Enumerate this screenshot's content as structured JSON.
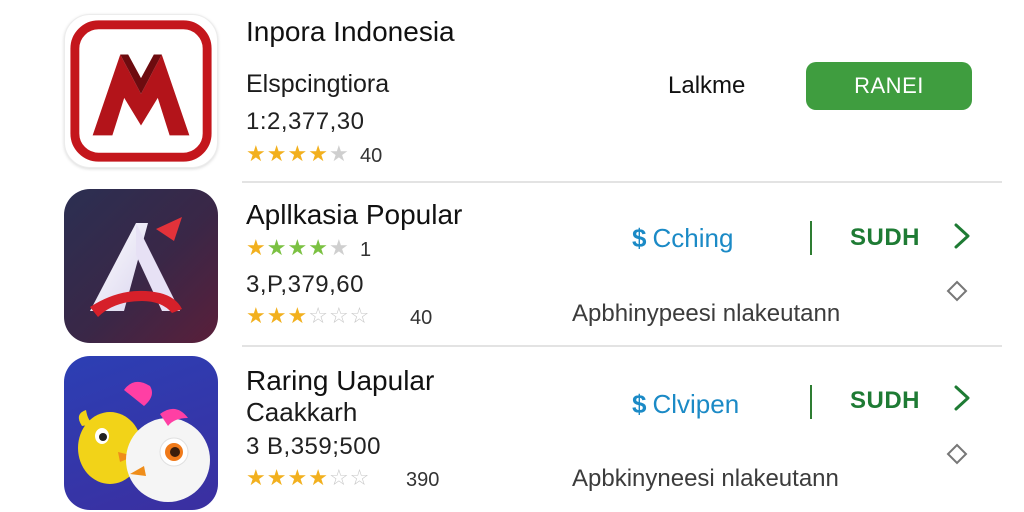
{
  "apps": [
    {
      "title": "Inpora Indonesia",
      "subtitle": "Elspcingtiora",
      "count": "1:2,377,30",
      "rating_value": "40",
      "stars": {
        "filled": 4,
        "total": 5,
        "color": "#f2b01e"
      },
      "action_label": "Lalkme",
      "install_button": "RANEI",
      "icon": "red-m-logo-icon"
    },
    {
      "title": "Apllkasia Popular",
      "rating_top": "1",
      "stars_top": {
        "filled": 4,
        "total": 5,
        "color": "#7bc142"
      },
      "count": "3,P,379,60",
      "rating_value": "40",
      "stars": {
        "filled": 3,
        "total": 5,
        "color": "#f2b01e"
      },
      "status_label": "Cching",
      "status_icon": "dollar-icon",
      "action_label": "SUDH",
      "description": "Apbhinypeesi nlakeutann",
      "icon": "letter-a-logo-icon"
    },
    {
      "title": "Raring Uapular",
      "subtitle": "Caakkarh",
      "count": "3 B,359;500",
      "rating_value": "390",
      "stars": {
        "filled": 4,
        "total": 5,
        "color": "#f2b01e"
      },
      "status_label": "Clvipen",
      "status_icon": "dollar-icon",
      "action_label": "SUDH",
      "description": "Apbkinyneesi nlakeutann",
      "icon": "bird-characters-icon"
    }
  ],
  "colors": {
    "install_green": "#3f9d3f",
    "status_blue": "#1b8ac6",
    "action_green": "#1e7b34",
    "star_gold": "#f2b01e",
    "star_green": "#7bc142"
  }
}
